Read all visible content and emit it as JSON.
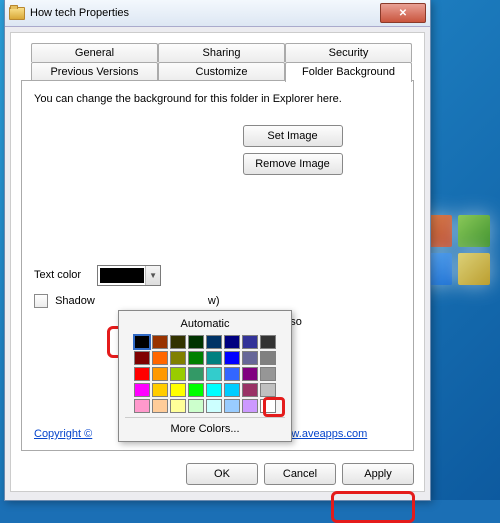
{
  "window": {
    "title": "How tech Properties"
  },
  "tabs": {
    "general": "General",
    "sharing": "Sharing",
    "security": "Security",
    "previous": "Previous Versions",
    "customize": "Customize",
    "folderbg": "Folder Background"
  },
  "panel": {
    "desc": "You can change the background for this folder in Explorer here.",
    "setimage": "Set Image",
    "removeimage": "Remove Image",
    "textcolor_label": "Text color",
    "shadow_label": "Shadow",
    "shadow_tail": "w)",
    "subfolders_tail": "y to sub folders also",
    "copyright": "Copyright ©",
    "link": "e www.aveapps.com"
  },
  "picker": {
    "automatic": "Automatic",
    "more": "More Colors...",
    "colors": [
      "#000000",
      "#993300",
      "#333300",
      "#003300",
      "#003366",
      "#000080",
      "#333399",
      "#333333",
      "#800000",
      "#ff6600",
      "#808000",
      "#008000",
      "#008080",
      "#0000ff",
      "#666699",
      "#808080",
      "#ff0000",
      "#ff9900",
      "#99cc00",
      "#339966",
      "#33cccc",
      "#3366ff",
      "#800080",
      "#969696",
      "#ff00ff",
      "#ffcc00",
      "#ffff00",
      "#00ff00",
      "#00ffff",
      "#00ccff",
      "#993366",
      "#c0c0c0",
      "#ff99cc",
      "#ffcc99",
      "#ffff99",
      "#ccffcc",
      "#ccffff",
      "#99ccff",
      "#cc99ff",
      "#ffffff"
    ]
  },
  "buttons": {
    "ok": "OK",
    "cancel": "Cancel",
    "apply": "Apply"
  }
}
